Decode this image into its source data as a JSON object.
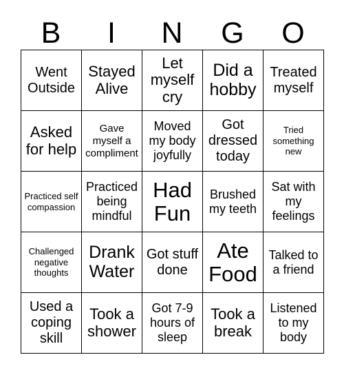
{
  "card": {
    "title_letters": [
      "B",
      "I",
      "N",
      "G",
      "O"
    ],
    "columns": 5,
    "rows": 5,
    "text_color": "#000000",
    "border_color": "#000000",
    "background_color": "#ffffff"
  },
  "grid": {
    "rows": [
      [
        {
          "text": "Went Outside",
          "size": "lg"
        },
        {
          "text": "Stayed Alive",
          "size": "xl"
        },
        {
          "text": "Let myself cry",
          "size": "xl"
        },
        {
          "text": "Did a hobby",
          "size": "2xl"
        },
        {
          "text": "Treated myself",
          "size": "lg"
        }
      ],
      [
        {
          "text": "Asked for help",
          "size": "xl"
        },
        {
          "text": "Gave myself a compliment",
          "size": "sm"
        },
        {
          "text": "Moved my body joyfully",
          "size": "md"
        },
        {
          "text": "Got dressed today",
          "size": "lg"
        },
        {
          "text": "Tried something new",
          "size": "xs"
        }
      ],
      [
        {
          "text": "Practiced self compassion",
          "size": "xs"
        },
        {
          "text": "Practiced being mindful",
          "size": "md"
        },
        {
          "text": "Had Fun",
          "size": "3xl"
        },
        {
          "text": "Brushed my teeth",
          "size": "md"
        },
        {
          "text": "Sat with my feelings",
          "size": "md"
        }
      ],
      [
        {
          "text": "Challenged negative thoughts",
          "size": "xs"
        },
        {
          "text": "Drank Water",
          "size": "2xl"
        },
        {
          "text": "Got stuff done",
          "size": "lg"
        },
        {
          "text": "Ate Food",
          "size": "3xl"
        },
        {
          "text": "Talked to a friend",
          "size": "md"
        }
      ],
      [
        {
          "text": "Used a coping skill",
          "size": "lg"
        },
        {
          "text": "Took a shower",
          "size": "xl"
        },
        {
          "text": "Got 7-9 hours of sleep",
          "size": "md"
        },
        {
          "text": "Took a break",
          "size": "xl"
        },
        {
          "text": "Listened to my body",
          "size": "md"
        }
      ]
    ]
  }
}
